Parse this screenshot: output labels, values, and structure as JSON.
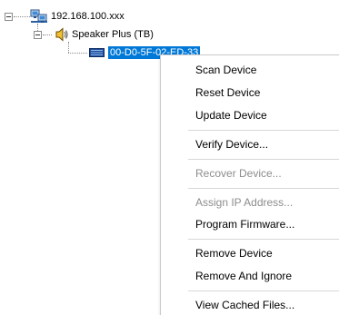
{
  "tree": {
    "root": {
      "label": "192.168.100.xxx",
      "icon": "network-computer-icon"
    },
    "child": {
      "label": "Speaker Plus (TB)",
      "icon": "speaker-icon"
    },
    "leaf": {
      "label": "00-D0-5F-02-ED-33",
      "icon": "device-icon",
      "selected": true
    }
  },
  "context_menu": {
    "items": [
      {
        "label": "Scan Device",
        "enabled": true
      },
      {
        "label": "Reset Device",
        "enabled": true
      },
      {
        "label": "Update Device",
        "enabled": true
      },
      {
        "label": "Verify Device...",
        "enabled": true
      },
      {
        "label": "Recover Device...",
        "enabled": false
      },
      {
        "label": "Assign IP Address...",
        "enabled": false
      },
      {
        "label": "Program Firmware...",
        "enabled": true
      },
      {
        "label": "Remove Device",
        "enabled": true
      },
      {
        "label": "Remove And Ignore",
        "enabled": true
      },
      {
        "label": "View Cached Files...",
        "enabled": true
      }
    ]
  },
  "colors": {
    "selection": "#0078d7",
    "disabled_text": "#8d8d8d"
  }
}
